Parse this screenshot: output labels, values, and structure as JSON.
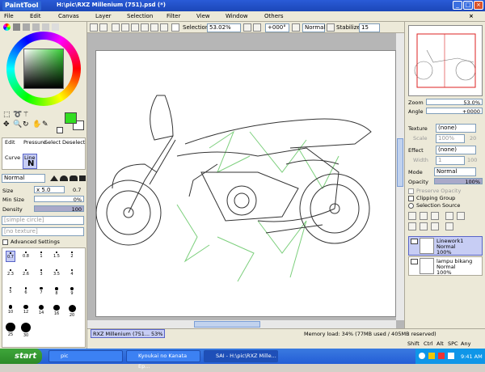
{
  "titlebar": {
    "app_logo": "PaintTool SAI",
    "title": "H:\\pic\\RXZ Millenium (751).psd (*)"
  },
  "menu": [
    "File",
    "Edit",
    "Canvas",
    "Layer",
    "Selection",
    "Filter",
    "View",
    "Window",
    "Others"
  ],
  "toolbar": {
    "selection_label": "Selection",
    "zoom": "53.02%",
    "rotation": "+000°",
    "blend": "Normal",
    "stabilizer_label": "Stabilizer",
    "stabilizer_value": "15"
  },
  "tools": {
    "edit_label": "Edit",
    "pressure_label": "Pressure",
    "select_label": "Select",
    "deselect_label": "Deselect",
    "curve_label": "Curve",
    "line_label": "Line",
    "mode": "Normal",
    "size_label": "Size",
    "size_mult": "x 5.0",
    "size_value": "0.7",
    "min_size_label": "Min Size",
    "min_size_value": "0%",
    "density_label": "Density",
    "density_value": "100",
    "shape_placeholder": "[simple circle]",
    "texture_placeholder": "[no texture]",
    "advanced_label": "Advanced Settings",
    "brush_sizes": [
      "0.7",
      "0.8",
      "1",
      "1.5",
      "2",
      "2.3",
      "2.6",
      "3",
      "3.5",
      "4",
      "5",
      "6",
      "7",
      "8",
      "9",
      "10",
      "12",
      "14",
      "16",
      "20",
      "25",
      "30"
    ]
  },
  "navigator": {
    "zoom_label": "Zoom",
    "zoom_value": "53.0%",
    "angle_label": "Angle",
    "angle_value": "+0000"
  },
  "props": {
    "texture_label": "Texture",
    "texture_value": "(none)",
    "scale_label": "Scale",
    "scale_value": "100%",
    "scale_right": "20",
    "effect_label": "Effect",
    "effect_value": "(none)",
    "width_label": "Width",
    "width_value": "1",
    "width_right": "100",
    "mode_label": "Mode",
    "mode_value": "Normal",
    "opacity_label": "Opacity",
    "opacity_value": "100%",
    "preserve_opacity": "Preserve Opacity",
    "clipping_group": "Clipping Group",
    "selection_source": "Selection Source"
  },
  "layers": [
    {
      "name": "Linework1",
      "mode": "Normal",
      "opacity": "100%",
      "selected": true
    },
    {
      "name": "lampu bikang",
      "mode": "Normal",
      "opacity": "100%",
      "selected": false
    }
  ],
  "document_tab": {
    "name": "RXZ Millenium (751...",
    "zoom": "53%"
  },
  "status": {
    "memory": "Memory load: 34% (77MB used / 405MB reserved)",
    "keys": [
      "Shift",
      "Ctrl",
      "Alt",
      "SPC",
      "Any"
    ]
  },
  "taskbar": {
    "start": "start",
    "items": [
      "pic",
      "Kyoukai no Kanata Ep...",
      "SAI - H:\\pic\\RXZ Mille..."
    ],
    "time": "9:41 AM"
  },
  "colors": {
    "current_color": "#33dd22",
    "secondary_color": "#ffffff",
    "sketch_green": "#7ccf7c"
  }
}
